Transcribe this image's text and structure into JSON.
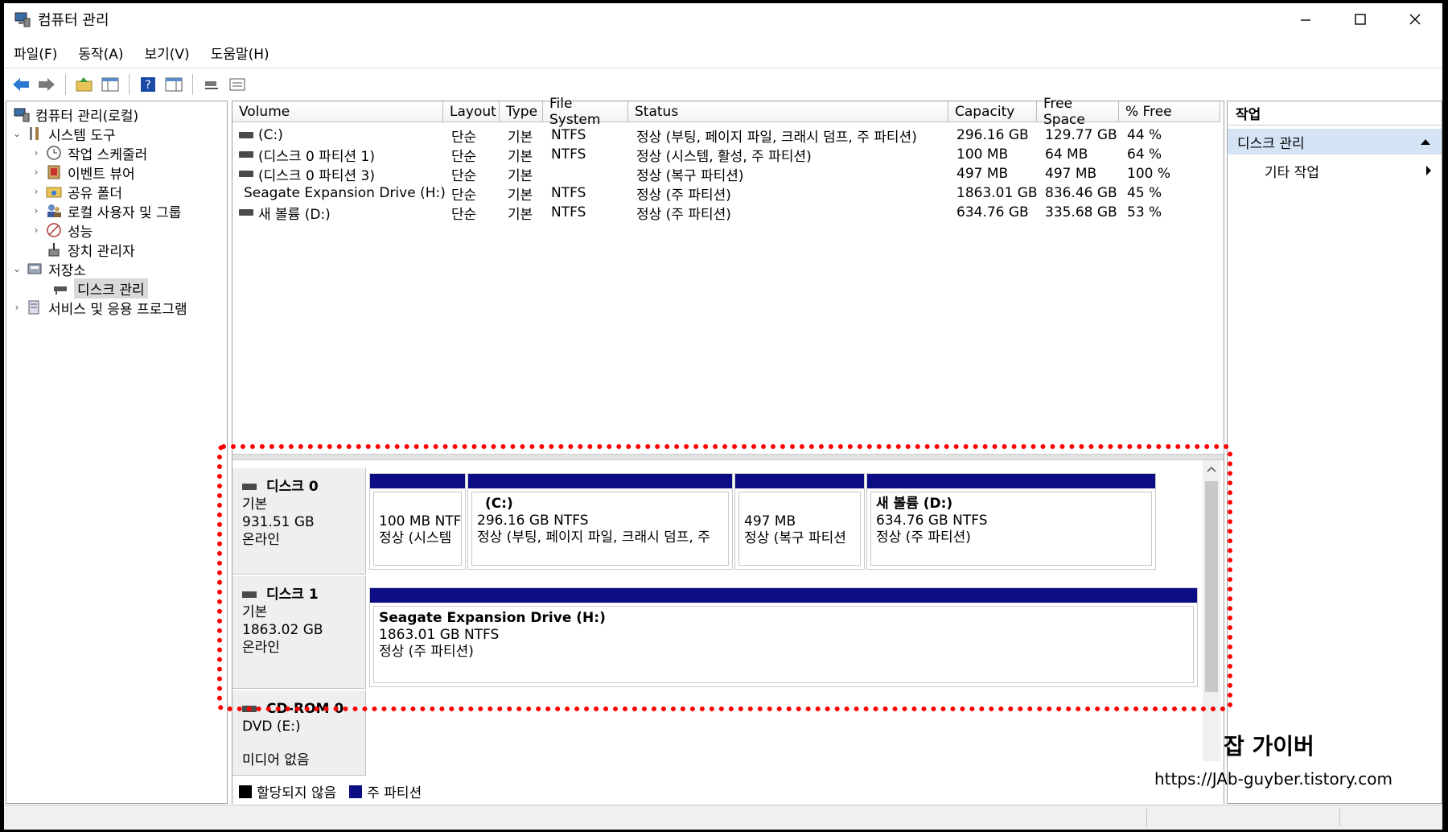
{
  "window": {
    "title": "컴퓨터 관리"
  },
  "menu": [
    "파일(F)",
    "동작(A)",
    "보기(V)",
    "도움말(H)"
  ],
  "tree": {
    "root": "컴퓨터 관리(로컬)",
    "system_tools": "시스템 도구",
    "task_scheduler": "작업 스케줄러",
    "event_viewer": "이벤트 뷰어",
    "shared_folders": "공유 폴더",
    "local_users": "로컬 사용자 및 그룹",
    "performance": "성능",
    "device_manager": "장치 관리자",
    "storage": "저장소",
    "disk_management": "디스크 관리",
    "services": "서비스 및 응용 프로그램"
  },
  "volumes": {
    "columns": [
      "Volume",
      "Layout",
      "Type",
      "File System",
      "Status",
      "Capacity",
      "Free Space",
      "% Free"
    ],
    "rows": [
      {
        "volume": "(C:)",
        "layout": "단순",
        "type": "기본",
        "fs": "NTFS",
        "status": "정상 (부팅, 페이지 파일, 크래시 덤프, 주 파티션)",
        "capacity": "296.16 GB",
        "free": "129.77 GB",
        "pct": "44 %"
      },
      {
        "volume": "(디스크 0 파티션 1)",
        "layout": "단순",
        "type": "기본",
        "fs": "NTFS",
        "status": "정상 (시스템, 활성, 주 파티션)",
        "capacity": "100 MB",
        "free": "64 MB",
        "pct": "64 %"
      },
      {
        "volume": "(디스크 0 파티션 3)",
        "layout": "단순",
        "type": "기본",
        "fs": "",
        "status": "정상 (복구 파티션)",
        "capacity": "497 MB",
        "free": "497 MB",
        "pct": "100 %"
      },
      {
        "volume": "Seagate Expansion Drive (H:)",
        "layout": "단순",
        "type": "기본",
        "fs": "NTFS",
        "status": "정상 (주 파티션)",
        "capacity": "1863.01 GB",
        "free": "836.46 GB",
        "pct": "45 %"
      },
      {
        "volume": "새 볼륨 (D:)",
        "layout": "단순",
        "type": "기본",
        "fs": "NTFS",
        "status": "정상 (주 파티션)",
        "capacity": "634.76 GB",
        "free": "335.68 GB",
        "pct": "53 %"
      }
    ]
  },
  "disks": {
    "disk0": {
      "name": "디스크 0",
      "type": "기본",
      "size": "931.51 GB",
      "state": "온라인",
      "partitions": [
        {
          "title": "",
          "line1": "100 MB NTF",
          "line2": "정상 (시스템"
        },
        {
          "title": "(C:)",
          "line1": "296.16 GB NTFS",
          "line2": "정상 (부팅, 페이지 파일, 크래시 덤프, 주"
        },
        {
          "title": "",
          "line1": "497 MB",
          "line2": "정상 (복구 파티션"
        },
        {
          "title": "새 볼륨  (D:)",
          "line1": "634.76 GB NTFS",
          "line2": "정상 (주 파티션)"
        }
      ]
    },
    "disk1": {
      "name": "디스크 1",
      "type": "기본",
      "size": "1863.02 GB",
      "state": "온라인",
      "partition": {
        "title": "Seagate Expansion Drive  (H:)",
        "line1": "1863.01 GB NTFS",
        "line2": "정상 (주 파티션)"
      }
    },
    "cdrom0": {
      "name": "CD-ROM 0",
      "type": "DVD (E:)",
      "state": "미디어 없음"
    }
  },
  "legend": {
    "unallocated": "할당되지 않음",
    "primary": "주 파티션",
    "unallocated_color": "#000000",
    "primary_color": "#0c0c84"
  },
  "actions": {
    "title": "작업",
    "section": "디스크 관리",
    "item": "기타 작업"
  },
  "watermark": {
    "title": "잡 가이버",
    "url": "https://JAb-guyber.tistory.com"
  },
  "colors": {
    "highlight": "#ff0000",
    "partition_bar": "#0c0c84",
    "action_section_bg": "#d5e4f5"
  }
}
